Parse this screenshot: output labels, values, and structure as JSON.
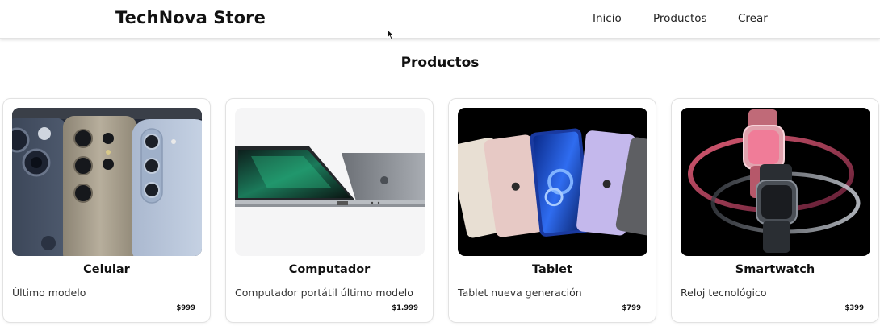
{
  "navbar": {
    "brand": "TechNova Store",
    "links": [
      {
        "label": "Inicio"
      },
      {
        "label": "Productos"
      },
      {
        "label": "Crear"
      }
    ]
  },
  "main": {
    "title": "Productos",
    "products": [
      {
        "name": "Celular",
        "description": "Último modelo",
        "price": "$999",
        "image_icon": "phone-image"
      },
      {
        "name": "Computador",
        "description": "Computador portátil último modelo",
        "price": "$1.999",
        "image_icon": "laptop-image"
      },
      {
        "name": "Tablet",
        "description": "Tablet nueva generación",
        "price": "$799",
        "image_icon": "tablet-image"
      },
      {
        "name": "Smartwatch",
        "description": "Reloj tecnológico",
        "price": "$399",
        "image_icon": "smartwatch-image"
      }
    ]
  },
  "colors": {
    "background": "#ffffff",
    "text": "#111111",
    "card_border": "#e2e2e2"
  }
}
